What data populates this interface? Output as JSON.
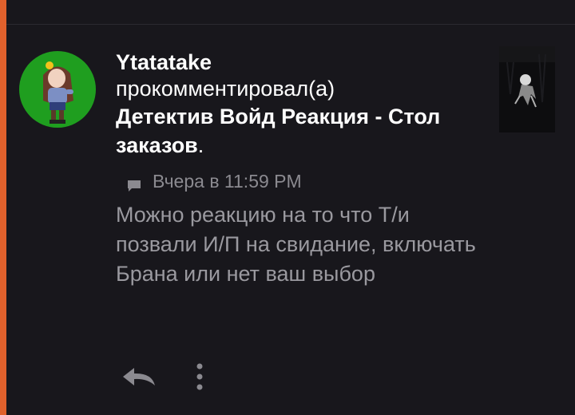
{
  "notification": {
    "username": "Ytatatake",
    "action": "прокомментировал(а)",
    "post_title": "Детектив Войд Реакция - Стол заказов",
    "title_suffix": ".",
    "timestamp": "Вчера в 11:59 PM",
    "comment": "Можно реакцию на то что Т/и позвали И/П на свидание, включать Брана или нет ваш выбор"
  },
  "icons": {
    "comment": "comment-icon",
    "reply": "reply-icon",
    "more": "more-vertical-icon"
  },
  "colors": {
    "background": "#18171c",
    "accent": "#e0612c",
    "avatar_bg": "#1f9e1f",
    "primary_text": "#ffffff",
    "secondary_text": "#9a999f"
  }
}
